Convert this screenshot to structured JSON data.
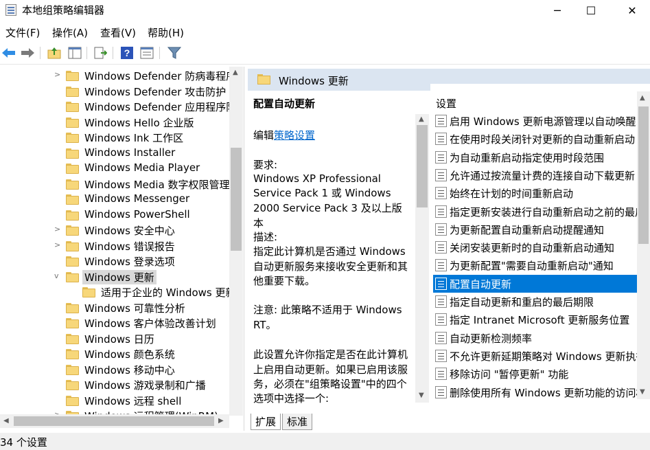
{
  "window": {
    "title": "本地组策略编辑器",
    "minimize": "─",
    "maximize": "☐",
    "close": "✕"
  },
  "menu": [
    "文件(F)",
    "操作(A)",
    "查看(V)",
    "帮助(H)"
  ],
  "toolbar": {
    "back": "back-arrow-icon",
    "forward": "forward-arrow-icon",
    "up": "up-folder-icon",
    "showhide": "show-hide-tree-icon",
    "export": "export-list-icon",
    "help": "help-icon",
    "properties": "properties-icon",
    "filter": "filter-icon"
  },
  "tree": {
    "items": [
      {
        "label": "Windows Defender 防病毒程序",
        "expander": ">",
        "indent": 0
      },
      {
        "label": "Windows Defender 攻击防护",
        "expander": "",
        "indent": 0
      },
      {
        "label": "Windows Defender 应用程序防",
        "expander": "",
        "indent": 0
      },
      {
        "label": "Windows Hello 企业版",
        "expander": "",
        "indent": 0
      },
      {
        "label": "Windows Ink 工作区",
        "expander": "",
        "indent": 0
      },
      {
        "label": "Windows Installer",
        "expander": "",
        "indent": 0
      },
      {
        "label": "Windows Media Player",
        "expander": "",
        "indent": 0
      },
      {
        "label": "Windows Media 数字权限管理",
        "expander": "",
        "indent": 0
      },
      {
        "label": "Windows Messenger",
        "expander": "",
        "indent": 0
      },
      {
        "label": "Windows PowerShell",
        "expander": "",
        "indent": 0
      },
      {
        "label": "Windows 安全中心",
        "expander": ">",
        "indent": 0
      },
      {
        "label": "Windows 错误报告",
        "expander": ">",
        "indent": 0
      },
      {
        "label": "Windows 登录选项",
        "expander": "",
        "indent": 0
      },
      {
        "label": "Windows 更新",
        "expander": "v",
        "indent": 0,
        "selected": true
      },
      {
        "label": "适用于企业的 Windows 更新",
        "expander": "",
        "indent": 1
      },
      {
        "label": "Windows 可靠性分析",
        "expander": "",
        "indent": 0
      },
      {
        "label": "Windows 客户体验改善计划",
        "expander": "",
        "indent": 0
      },
      {
        "label": "Windows 日历",
        "expander": "",
        "indent": 0
      },
      {
        "label": "Windows 颜色系统",
        "expander": "",
        "indent": 0
      },
      {
        "label": "Windows 移动中心",
        "expander": "",
        "indent": 0
      },
      {
        "label": "Windows 游戏录制和广播",
        "expander": "",
        "indent": 0
      },
      {
        "label": "Windows 远程 shell",
        "expander": "",
        "indent": 0
      },
      {
        "label": "Windows 远程管理(WinRM)",
        "expander": ">",
        "indent": 0
      }
    ]
  },
  "header": {
    "title": "Windows 更新"
  },
  "description": {
    "title": "配置自动更新",
    "edit_prefix": "编辑",
    "edit_link": "策略设置",
    "req_label": "要求:",
    "req_line1": "Windows XP Professional",
    "req_line2": "Service Pack 1 或 Windows",
    "req_line3": "2000 Service Pack 3 及以上版本",
    "desc_label": "描述:",
    "desc_line1": "指定此计算机是否通过 Windows",
    "desc_line2": "自动更新服务来接收安全更新和其",
    "desc_line3": "他重要下载。",
    "note_line1": "注意: 此策略不适用于 Windows",
    "note_line2": "RT。",
    "para_line1": "此设置允许你指定是否在此计算机",
    "para_line2": "上启用自动更新。如果已启用该服",
    "para_line3": "务，必须在\"组策略设置\"中的四个",
    "para_line4": "选项中选择一个:"
  },
  "settings": {
    "column": "设置",
    "rows": [
      "启用 Windows 更新电源管理以自动唤醒系",
      "在使用时段关闭针对更新的自动重新启动",
      "为自动重新启动指定使用时段范围",
      "允许通过按流量计费的连接自动下载更新",
      "始终在计划的时间重新启动",
      "指定更新安装进行自动重新启动之前的最后",
      "为更新配置自动重新启动提醒通知",
      "关闭安装更新时的自动重新启动通知",
      "为更新配置\"需要自动重新启动\"通知",
      "配置自动更新",
      "指定自动更新和重启的最后期限",
      "指定 Intranet Microsoft 更新服务位置",
      "自动更新检测频率",
      "不允许更新延期策略对 Windows 更新执行",
      "移除访问 \"暂停更新\" 功能",
      "删除使用所有 Windows 更新功能的访问权"
    ],
    "selected_index": 9
  },
  "tabs": {
    "extended": "扩展",
    "standard": "标准"
  },
  "status": {
    "text": "34 个设置"
  }
}
